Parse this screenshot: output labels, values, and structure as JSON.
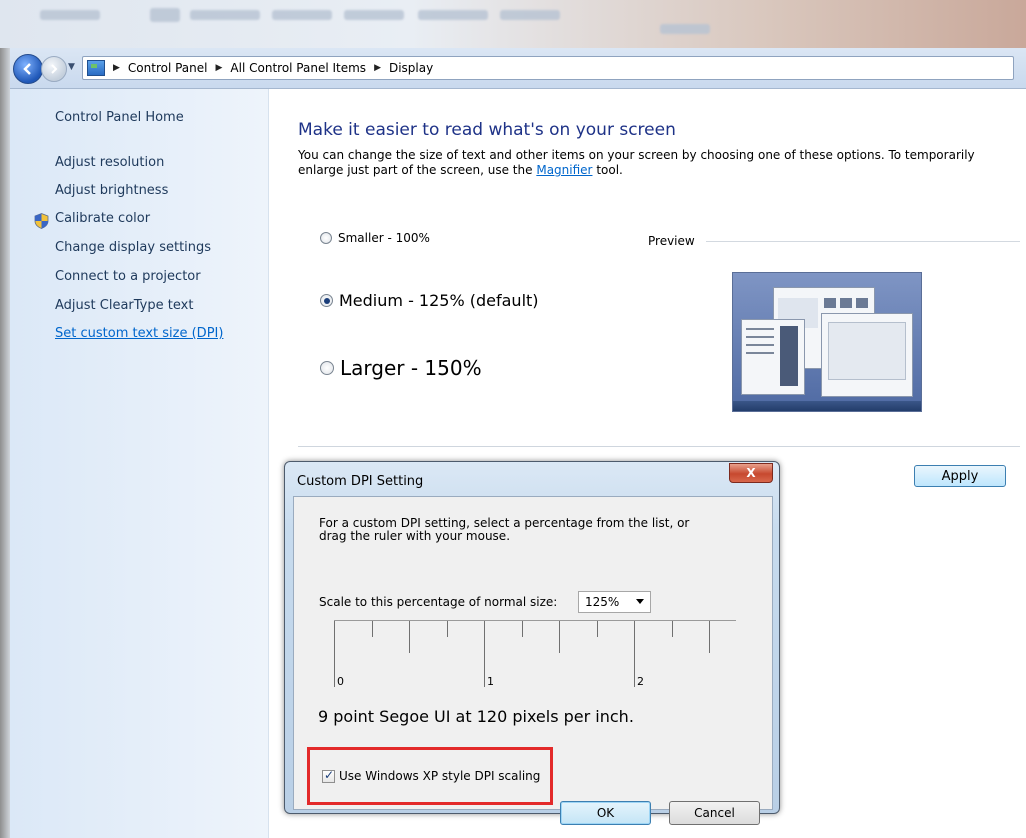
{
  "nav": {
    "breadcrumbs": [
      "Control Panel",
      "All Control Panel Items",
      "Display"
    ]
  },
  "sidebar": {
    "home": "Control Panel Home",
    "items": [
      {
        "label": "Adjust resolution"
      },
      {
        "label": "Adjust brightness"
      },
      {
        "label": "Calibrate color",
        "icon": "uac-shield-icon"
      },
      {
        "label": "Change display settings"
      },
      {
        "label": "Connect to a projector"
      },
      {
        "label": "Adjust ClearType text"
      },
      {
        "label": "Set custom text size (DPI)",
        "active": true
      }
    ]
  },
  "main": {
    "heading": "Make it easier to read what's on your screen",
    "description_part1": "You can change the size of text and other items on your screen by choosing one of these options. To temporarily enlarge just part of the screen, use the",
    "magnifier_link": "Magnifier",
    "description_part2": "tool.",
    "options": [
      {
        "label": "Smaller - 100%",
        "checked": false
      },
      {
        "label": "Medium - 125% (default)",
        "checked": true
      },
      {
        "label": "Larger - 150%",
        "checked": false
      }
    ],
    "preview_label": "Preview",
    "apply_label": "Apply"
  },
  "dialog": {
    "title": "Custom DPI Setting",
    "close_label": "X",
    "instructions_line1": "For a custom DPI setting, select a percentage from the list, or",
    "instructions_line2": "drag the ruler with your mouse.",
    "scale_label": "Scale to this percentage of normal size:",
    "scale_value": "125%",
    "ruler_labels": [
      "0",
      "1",
      "2"
    ],
    "dpi_info": "9 point Segoe UI at 120 pixels per inch.",
    "xp_scaling_label": "Use Windows XP style DPI scaling",
    "xp_scaling_checked": true,
    "ok_label": "OK",
    "cancel_label": "Cancel"
  },
  "colors": {
    "heading": "#1e3287",
    "link": "#0066cc",
    "highlight": "#e32a2a"
  }
}
